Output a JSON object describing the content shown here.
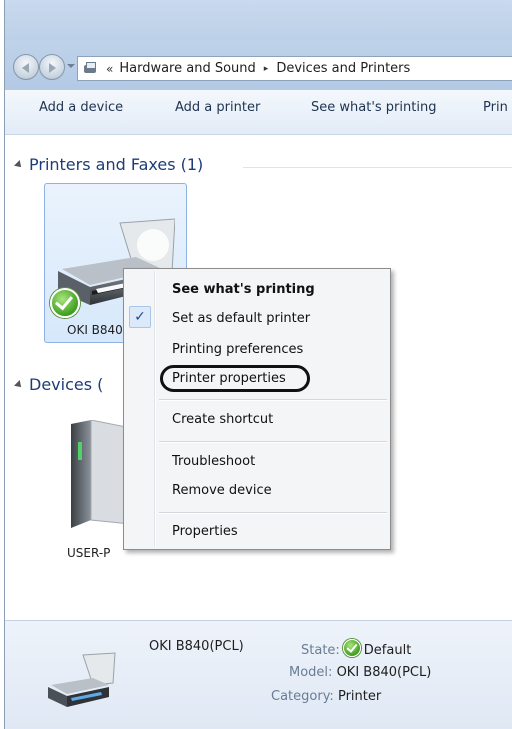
{
  "address": {
    "prefix": "«",
    "crumbs": [
      "Hardware and Sound",
      "Devices and Printers"
    ],
    "separator": "▸"
  },
  "toolbar": [
    "Add a device",
    "Add a printer",
    "See what's printing",
    "Prin"
  ],
  "groups": {
    "printers": "Printers and Faxes (1)",
    "devices": "Devices ("
  },
  "tiles": {
    "printer_label": "OKI B840",
    "computer_label": "USER-P"
  },
  "context_menu": {
    "items": [
      {
        "label": "See what's printing",
        "bold": true
      },
      {
        "label": "Set as default printer",
        "checked": true
      },
      {
        "label": "Printing preferences"
      },
      {
        "label": "Printer properties",
        "highlighted": true
      },
      {
        "label": "Create shortcut"
      },
      {
        "label": "Troubleshoot"
      },
      {
        "label": "Remove device"
      },
      {
        "label": "Properties"
      }
    ],
    "check_glyph": "✓"
  },
  "details": {
    "name": "OKI B840(PCL)",
    "state_label": "State:",
    "state_value": "Default",
    "model_label": "Model:",
    "model_value": "OKI B840(PCL)",
    "category_label": "Category:",
    "category_value": "Printer"
  },
  "colors": {
    "accent": "#1e3c78",
    "selection": "#d6e8fb",
    "status_ok": "#3f9f1f"
  }
}
